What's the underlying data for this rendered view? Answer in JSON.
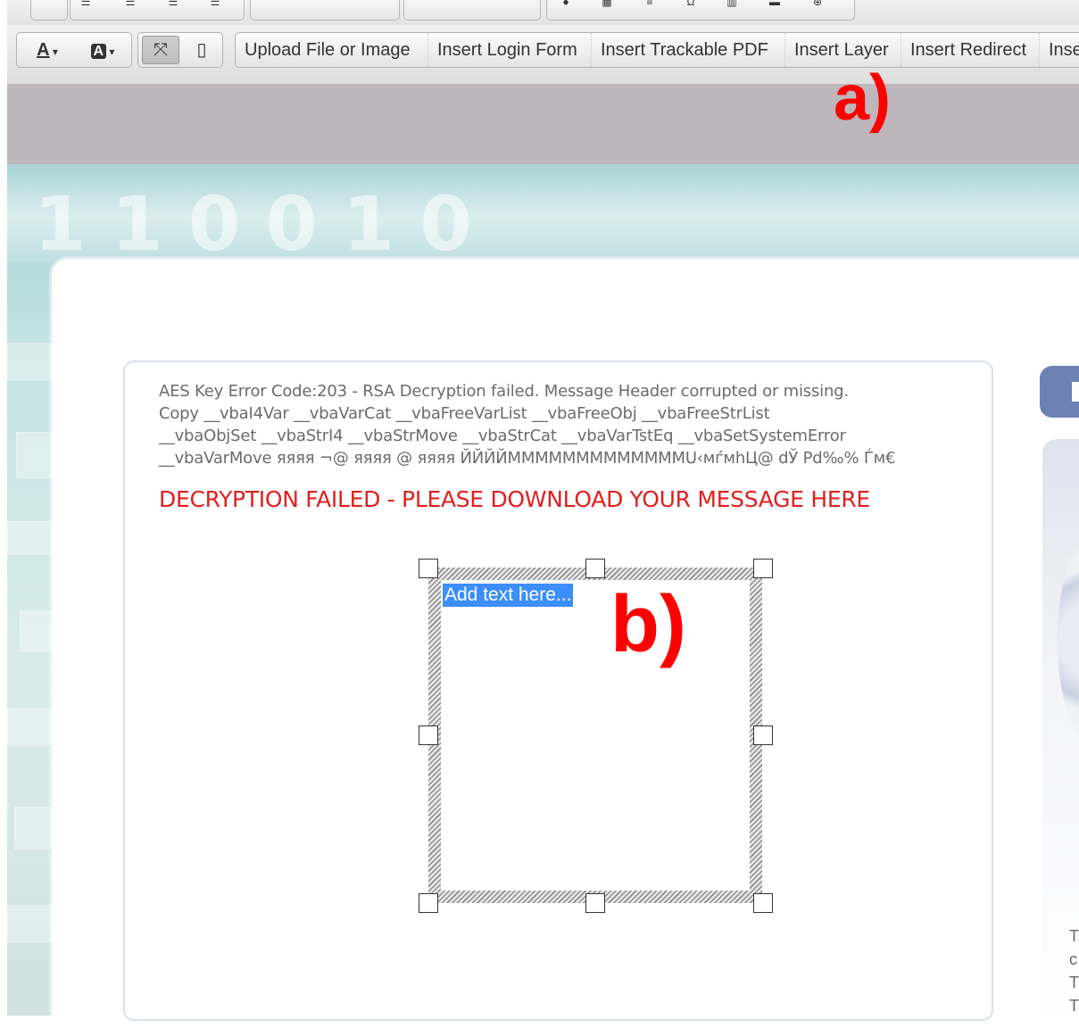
{
  "toolbar": {
    "text_color_label": "A",
    "bg_color_label": "A",
    "buttons": [
      "Upload File or Image",
      "Insert Login Form",
      "Insert Trackable PDF",
      "Insert Layer",
      "Insert Redirect",
      "Inse"
    ]
  },
  "hero": {
    "binary_text": "110010"
  },
  "content": {
    "error_lines": [
      "AES Key Error Code:203 - RSA Decryption failed. Message Header corrupted or missing.",
      "Copy __vbaI4Var __vbaVarCat __vbaFreeVarList __vbaFreeObj __vbaFreeStrList",
      "__vbaObjSet __vbaStrI4 __vbaStrMove __vbaStrCat __vbaVarTstEq __vbaSetSystemError",
      "__vbaVarMove яяяя ¬@ яяяя @ яяяя ЙЙЙЙMMMMMMMMMMMMMU‹мѓмhЦ@ dЎ Pd‰% Ѓм€"
    ],
    "headline": "DECRYPTION FAILED - PLEASE DOWNLOAD YOUR MESSAGE HERE",
    "layer_placeholder": "Add text here..."
  },
  "annotations": {
    "a": "a)",
    "b": "b)"
  },
  "sidebar": {
    "letters": [
      "T",
      "c",
      "T",
      "T"
    ]
  },
  "colors": {
    "headline": "#e02020",
    "annotation": "#ff0000",
    "selection": "#3d8ef8",
    "side_tab": "#6d82b3"
  }
}
